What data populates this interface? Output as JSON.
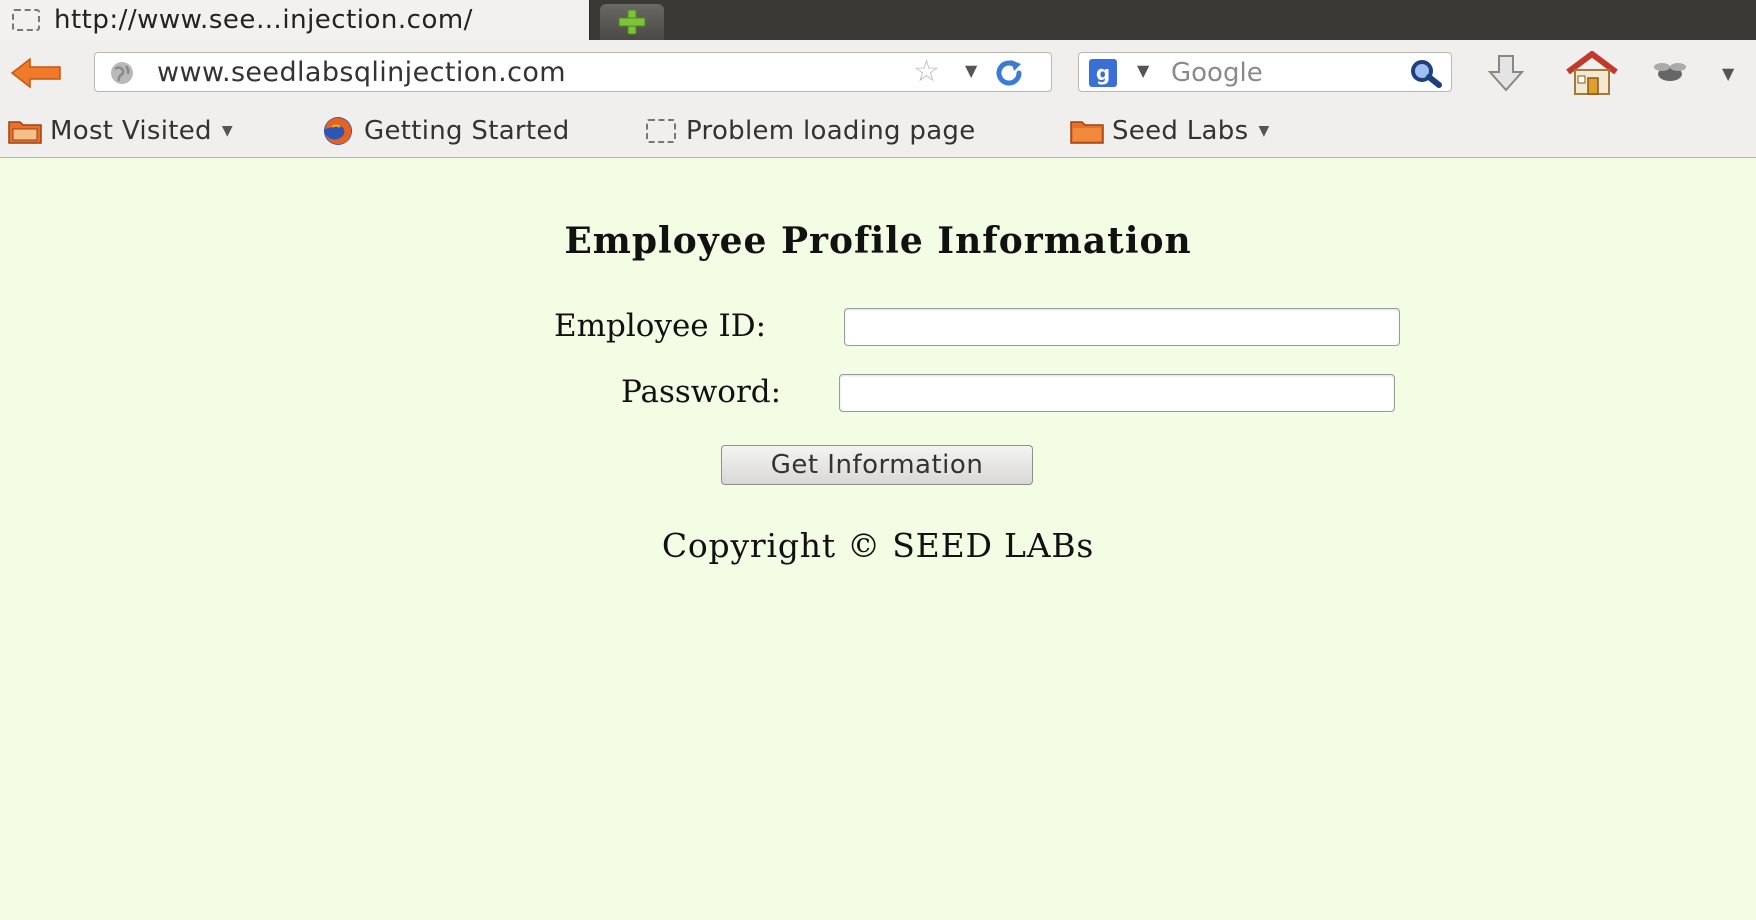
{
  "browser": {
    "tab": {
      "title": "http://www.see…injection.com/"
    },
    "new_tab_icon": "plus-icon",
    "url": "www.seedlabsqlinjection.com",
    "search": {
      "placeholder": "Google",
      "engine_icon": "google-icon"
    },
    "icons": {
      "back": "back-arrow-icon",
      "globe": "globe-icon",
      "star": "bookmark-star-icon",
      "reload": "reload-icon",
      "search": "magnifier-icon",
      "download": "download-icon",
      "home": "home-icon",
      "addon": "addon-icon"
    },
    "bookmarks": [
      {
        "label": "Most Visited",
        "icon": "folder-icon",
        "has_dropdown": true
      },
      {
        "label": "Getting Started",
        "icon": "firefox-icon",
        "has_dropdown": false
      },
      {
        "label": "Problem loading page",
        "icon": "blank-page-icon",
        "has_dropdown": false
      },
      {
        "label": "Seed Labs",
        "icon": "folder-icon",
        "has_dropdown": true
      }
    ]
  },
  "page": {
    "background": "#F2FDE4",
    "heading": "Employee Profile Information",
    "form": {
      "employee_id_label": "Employee ID:",
      "employee_id_value": "",
      "password_label": "Password:",
      "password_value": "",
      "submit_label": "Get Information"
    },
    "copyright": "Copyright © SEED LABs"
  }
}
